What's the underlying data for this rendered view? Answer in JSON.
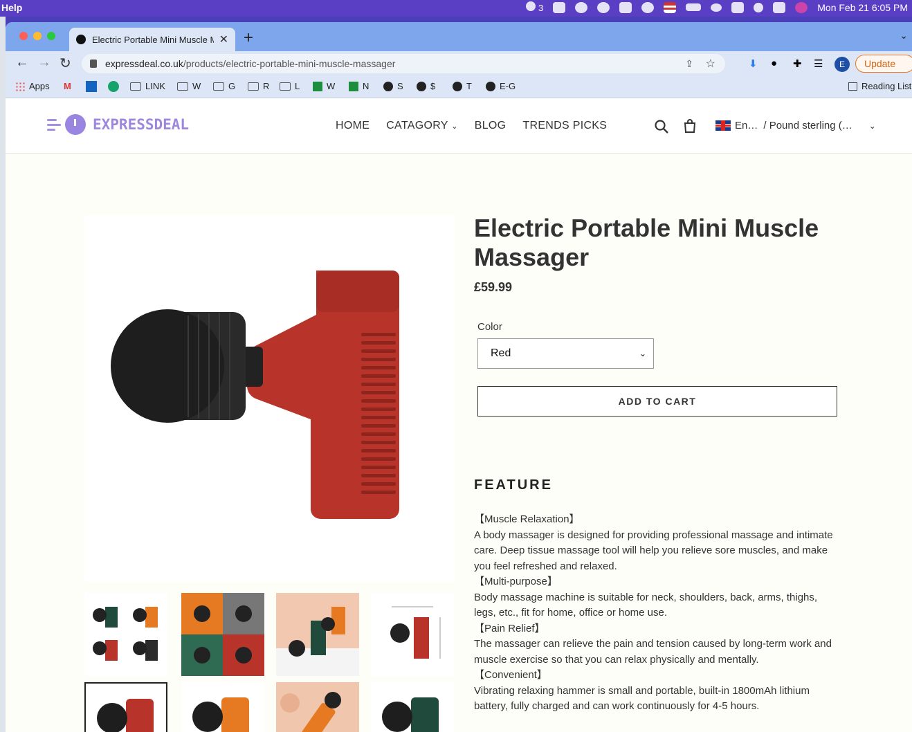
{
  "menubar": {
    "help": "Help",
    "badge_count": "3",
    "datetime": "Mon Feb 21  6:05 PM"
  },
  "browser": {
    "tab_title": "Electric Portable Mini Muscle Massager",
    "url_domain": "expressdeal.co.uk",
    "url_path": "/products/electric-portable-mini-muscle-massager",
    "profile_initial": "E",
    "update_label": "Update",
    "bookmarks": [
      "Apps",
      "LINK",
      "W",
      "G",
      "R",
      "L",
      "W",
      "N",
      "S",
      "$",
      "T",
      "E-G"
    ],
    "reading_list": "Reading List"
  },
  "site": {
    "logo_text": "EXPRESSDEAL",
    "nav": [
      "HOME",
      "CATAGORY",
      "BLOG",
      "TRENDS PICKS"
    ],
    "language": "En…",
    "currency": "/ Pound sterling (…"
  },
  "product": {
    "title": "Electric Portable Mini Muscle Massager",
    "price": "£59.99",
    "color_label": "Color",
    "color_value": "Red",
    "add_to_cart": "ADD TO CART",
    "feature_heading": "FEATURE",
    "features": [
      {
        "heading": "【Muscle Relaxation】",
        "text": "A body massager is designed for providing professional massage and intimate care. Deep tissue massage tool will help you relieve sore muscles, and make you feel refreshed and relaxed."
      },
      {
        "heading": "【Multi-purpose】",
        "text": "Body massage machine is suitable for neck, shoulders, back, arms, thighs, legs, etc., fit for home, office or home use."
      },
      {
        "heading": "【Pain Relief】",
        "text": "The massager can relieve the pain and tension caused by long-term work and muscle exercise so that you can relax physically and mentally."
      },
      {
        "heading": "【Convenient】",
        "text": "Vibrating relaxing hammer is small and portable, built-in 1800mAh lithium battery, fully charged and can work continuously for 4-5 hours."
      }
    ]
  },
  "colors": {
    "accent": "#9d86de",
    "menubar": "#5a3fc4",
    "tabbar": "#7ea6ec",
    "toolbar": "#dce6f7",
    "product_red": "#b8342a",
    "product_orange": "#e67a22",
    "product_green": "#1f4a3c"
  }
}
